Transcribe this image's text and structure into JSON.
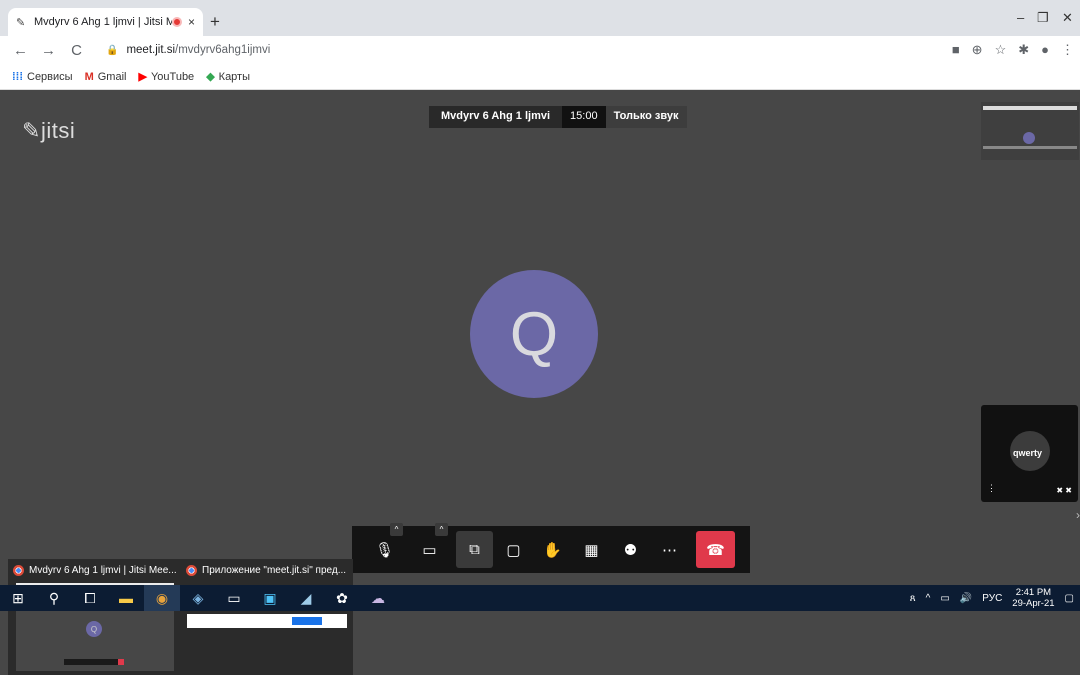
{
  "browser": {
    "tab_title": "Mvdyrv 6 Ahg 1 ljmvi | Jitsi M",
    "tab_close": "×",
    "new_tab": "+",
    "url_domain": "meet.jit.si",
    "url_path": "/mvdyrv6ahg1ijmvi",
    "window_controls": [
      "–",
      "❐",
      "✕"
    ]
  },
  "bookmarks": [
    {
      "icon": "apps-icon",
      "label": "Сервисы"
    },
    {
      "icon": "gmail-icon",
      "label": "Gmail"
    },
    {
      "icon": "youtube-icon",
      "label": "YouTube"
    },
    {
      "icon": "maps-icon",
      "label": "Карты"
    }
  ],
  "meeting": {
    "logo": "jitsi",
    "subject": "Mvdyrv 6 Ahg 1 ljmvi",
    "timer": "15:00",
    "audio_only_label": "Только звук",
    "avatar_letter": "Q",
    "remote_name": "qwerty"
  },
  "taskbar_preview": {
    "window1_title": "Mvdyrv 6 Ahg 1 ljmvi | Jitsi Mee...",
    "window2_title": "Приложение \"meet.jit.si\" пред..."
  },
  "tray": {
    "language": "РУС",
    "time": "2:41 PM",
    "date": "29-Apr-21"
  },
  "colors": {
    "stage_bg": "#474747",
    "avatar": "#6b68a6",
    "hangup": "#e0394b",
    "taskbar": "#0c1c33"
  }
}
